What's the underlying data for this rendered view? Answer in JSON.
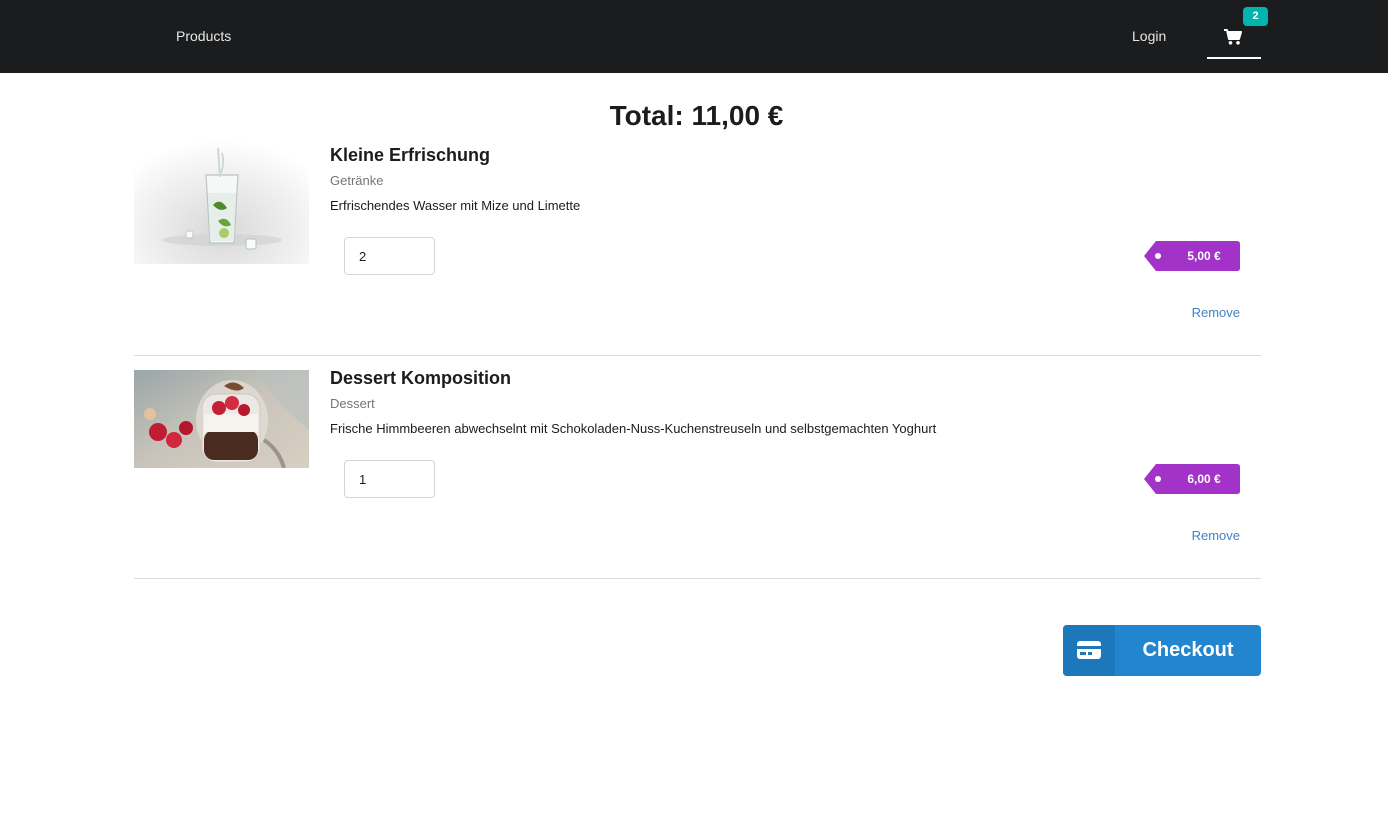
{
  "nav": {
    "products_label": "Products",
    "login_label": "Login",
    "cart_icon": "cart-icon",
    "cart_count": "2"
  },
  "cart": {
    "total_label": "Total: 11,00 €",
    "items": [
      {
        "name": "Kleine Erfrischung",
        "category": "Getränke",
        "description": "Erfrischendes Wasser mit Mize und Limette",
        "quantity": "2",
        "price": "5,00 €",
        "remove_label": "Remove",
        "image": "water-glass-image"
      },
      {
        "name": "Dessert Komposition",
        "category": "Dessert",
        "description": "Frische Himmbeeren abwechselnt mit Schokoladen-Nuss-Kuchenstreuseln und selbstgemachten Yoghurt",
        "quantity": "1",
        "price": "6,00 €",
        "remove_label": "Remove",
        "image": "dessert-jar-image"
      }
    ],
    "checkout_label": "Checkout",
    "checkout_icon": "credit-card-icon"
  },
  "colors": {
    "navbar": "#1b1c1d",
    "badge": "#00b5ad",
    "price_tag": "#a333c8",
    "link": "#4183c4",
    "checkout": "#2185d0"
  }
}
